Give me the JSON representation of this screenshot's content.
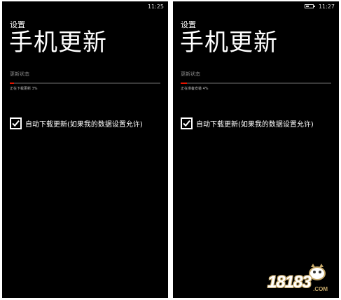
{
  "screens": [
    {
      "status_bar": {
        "time": "11:25",
        "battery": null
      },
      "section": "设置",
      "title": "手机更新",
      "status_label": "更新状态",
      "progress_text": "正在下载更新 3%",
      "progress_fraction": 0.03,
      "auto_download_label": "自动下载更新(如果我的数据设置允许)",
      "auto_download_checked": true
    },
    {
      "status_bar": {
        "time": "11:27",
        "battery": "battery-icon"
      },
      "section": "设置",
      "title": "手机更新",
      "status_label": "更新状态",
      "progress_text": "正在准备安装 4%",
      "progress_fraction": 0.04,
      "auto_download_label": "自动下载更新(如果我的数据设置允许)",
      "auto_download_checked": true
    }
  ],
  "colors": {
    "background": "#000000",
    "accent": "#e51400",
    "text": "#ffffff",
    "subtle": "#8a8a8a"
  },
  "watermark": {
    "text": "18183",
    "suffix": ".COM"
  }
}
